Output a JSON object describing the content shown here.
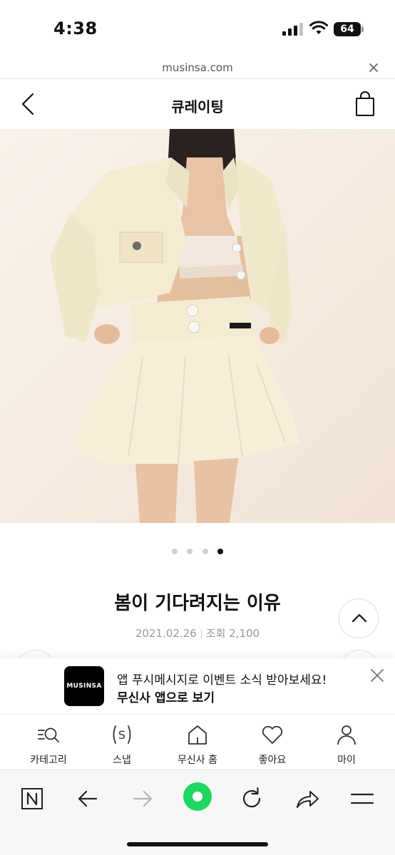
{
  "status_bar": {
    "time": "4:38",
    "battery": "64"
  },
  "url_bar": {
    "url": "musinsa.com"
  },
  "header": {
    "title": "큐레이팅"
  },
  "carousel": {
    "total": 4,
    "active_index": 3
  },
  "article": {
    "title": "봄이 기다려지는 이유",
    "date": "2021.02.26",
    "views": "조회 2,100"
  },
  "push_banner": {
    "logo_text": "MUSINSA",
    "message": "앱 푸시메시지로 이벤트 소식 받아보세요!",
    "cta": "무신사 앱으로 보기"
  },
  "bottom_nav": {
    "items": [
      {
        "label": "카테고리",
        "icon": "category-search-icon"
      },
      {
        "label": "스냅",
        "icon": "snap-icon"
      },
      {
        "label": "무신사 홈",
        "icon": "home-icon"
      },
      {
        "label": "좋아요",
        "icon": "heart-icon"
      },
      {
        "label": "마이",
        "icon": "user-icon"
      }
    ]
  },
  "colors": {
    "accent_green": "#1ed760",
    "text": "#111111",
    "meta_gray": "#9a9a9a",
    "hero_bg": "#f7efe5",
    "outfit_cream": "#f4ecd2"
  }
}
